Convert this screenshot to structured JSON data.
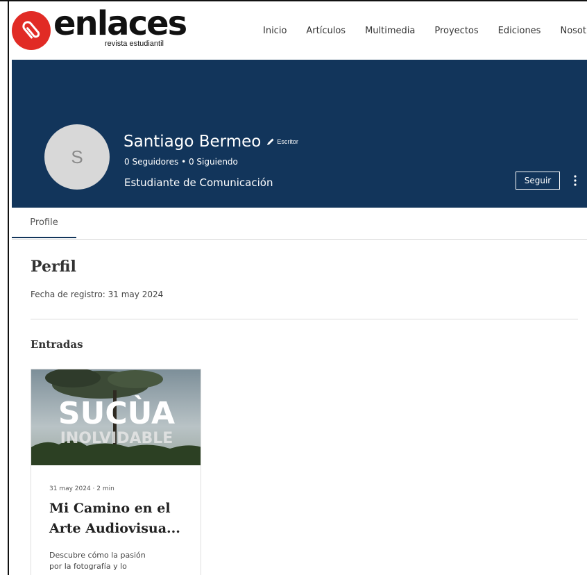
{
  "header": {
    "logo_text": "enlaces",
    "logo_subtitle": "revista estudiantil",
    "nav": [
      "Inicio",
      "Artículos",
      "Multimedia",
      "Proyectos",
      "Ediciones",
      "Nosotros"
    ]
  },
  "profile": {
    "avatar_initial": "S",
    "name": "Santiago Bermeo",
    "role": "Escritor",
    "followers_text": "0 Seguidores • 0 Siguiendo",
    "bio": "Estudiante de Comunicación",
    "follow_label": "Seguir"
  },
  "tabs": {
    "profile_label": "Profile"
  },
  "content": {
    "title": "Perfil",
    "registration": "Fecha de registro: 31 may 2024",
    "posts_title": "Entradas"
  },
  "post": {
    "image_title_1": "SUCÙA",
    "image_title_2": "INOLVIDABLE",
    "meta": "31 may 2024 · 2  min",
    "title": "Mi Camino en el Arte Audiovisua...",
    "excerpt": "Descubre cómo la pasión por la fotografía y lo"
  },
  "colors": {
    "brand_red": "#e12b25",
    "banner_blue": "#12355b"
  }
}
